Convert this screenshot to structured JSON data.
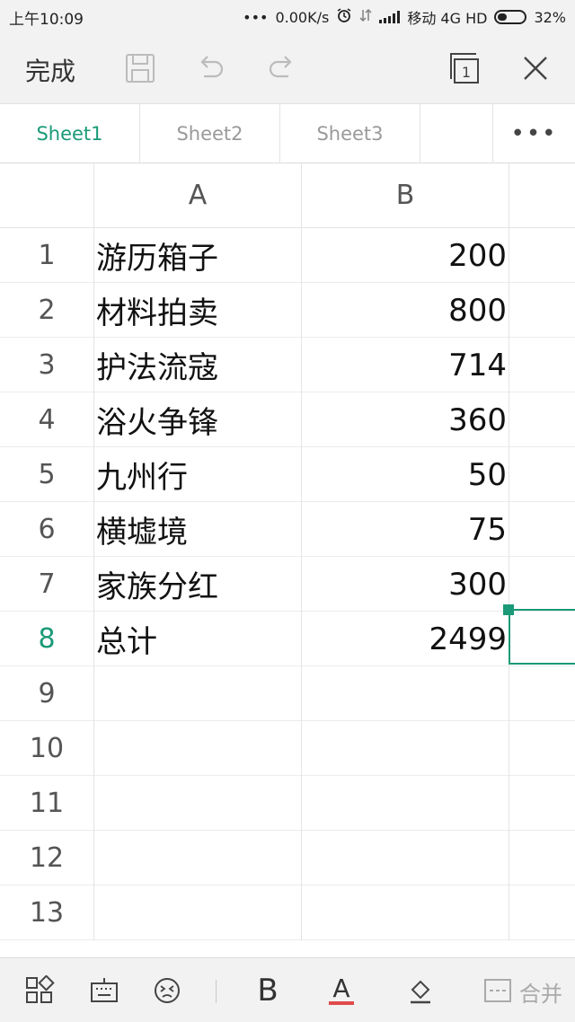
{
  "status_bar": {
    "time": "上午10:09",
    "dots": "•••",
    "net_speed": "0.00K/s",
    "carrier": "移动 4G HD",
    "battery": "32%"
  },
  "toolbar": {
    "done_label": "完成",
    "page_count": "1"
  },
  "sheet_tabs": [
    {
      "label": "Sheet1",
      "active": true
    },
    {
      "label": "Sheet2",
      "active": false
    },
    {
      "label": "Sheet3",
      "active": false
    }
  ],
  "more_tabs": "•••",
  "columns": [
    "A",
    "B"
  ],
  "rows": [
    {
      "num": "1",
      "a": "游历箱子",
      "b": "200"
    },
    {
      "num": "2",
      "a": "材料拍卖",
      "b": "800"
    },
    {
      "num": "3",
      "a": "护法流寇",
      "b": "714"
    },
    {
      "num": "4",
      "a": "浴火争锋",
      "b": "360"
    },
    {
      "num": "5",
      "a": "九州行",
      "b": "50"
    },
    {
      "num": "6",
      "a": "横墟境",
      "b": "75"
    },
    {
      "num": "7",
      "a": "家族分红",
      "b": "300"
    },
    {
      "num": "8",
      "a": "总计",
      "b": "2499"
    },
    {
      "num": "9",
      "a": "",
      "b": ""
    },
    {
      "num": "10",
      "a": "",
      "b": ""
    },
    {
      "num": "11",
      "a": "",
      "b": ""
    },
    {
      "num": "12",
      "a": "",
      "b": ""
    },
    {
      "num": "13",
      "a": "",
      "b": ""
    }
  ],
  "active_row": "8",
  "bottom_toolbar": {
    "bold_label": "B",
    "font_color_label": "A",
    "merge_label": "合并",
    "font_color": "#e04a4a"
  },
  "colors": {
    "accent": "#1a9a78",
    "toolbar_bg": "#f2f2f2"
  }
}
